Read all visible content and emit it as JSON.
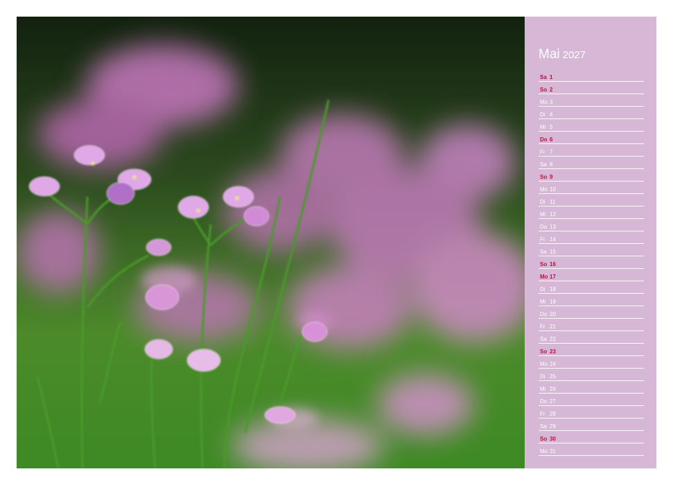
{
  "calendar": {
    "month": "Mai",
    "year": "2027",
    "days": [
      {
        "weekday": "Sa",
        "day": "1",
        "color": "#b0103a"
      },
      {
        "weekday": "So",
        "day": "2",
        "color": "#c0103a"
      },
      {
        "weekday": "Mo",
        "day": "3",
        "color": "#ffffff"
      },
      {
        "weekday": "Di",
        "day": "4",
        "color": "#ffffff"
      },
      {
        "weekday": "Mi",
        "day": "5",
        "color": "#ffffff"
      },
      {
        "weekday": "Do",
        "day": "6",
        "color": "#c0103a"
      },
      {
        "weekday": "Fr",
        "day": "7",
        "color": "#ffffff"
      },
      {
        "weekday": "Sa",
        "day": "8",
        "color": "#ffffff"
      },
      {
        "weekday": "So",
        "day": "9",
        "color": "#c0103a"
      },
      {
        "weekday": "Mo",
        "day": "10",
        "color": "#ffffff"
      },
      {
        "weekday": "Di",
        "day": "11",
        "color": "#ffffff"
      },
      {
        "weekday": "Mi",
        "day": "12",
        "color": "#ffffff"
      },
      {
        "weekday": "Do",
        "day": "13",
        "color": "#ffffff"
      },
      {
        "weekday": "Fr",
        "day": "14",
        "color": "#ffffff"
      },
      {
        "weekday": "Sa",
        "day": "15",
        "color": "#ffffff"
      },
      {
        "weekday": "So",
        "day": "16",
        "color": "#c0103a"
      },
      {
        "weekday": "Mo",
        "day": "17",
        "color": "#c0103a"
      },
      {
        "weekday": "Di",
        "day": "18",
        "color": "#ffffff"
      },
      {
        "weekday": "Mi",
        "day": "19",
        "color": "#ffffff"
      },
      {
        "weekday": "Do",
        "day": "20",
        "color": "#ffffff"
      },
      {
        "weekday": "Fr",
        "day": "21",
        "color": "#ffffff"
      },
      {
        "weekday": "Sa",
        "day": "22",
        "color": "#ffffff"
      },
      {
        "weekday": "So",
        "day": "23",
        "color": "#c0103a"
      },
      {
        "weekday": "Mo",
        "day": "24",
        "color": "#ffffff"
      },
      {
        "weekday": "Di",
        "day": "25",
        "color": "#ffffff"
      },
      {
        "weekday": "Mi",
        "day": "26",
        "color": "#ffffff"
      },
      {
        "weekday": "Do",
        "day": "27",
        "color": "#ffffff"
      },
      {
        "weekday": "Fr",
        "day": "28",
        "color": "#ffffff"
      },
      {
        "weekday": "Sa",
        "day": "29",
        "color": "#ffffff"
      },
      {
        "weekday": "So",
        "day": "30",
        "color": "#c0103a"
      },
      {
        "weekday": "Mo",
        "day": "31",
        "color": "#ffffff"
      }
    ]
  },
  "colors": {
    "sidebar": "#d6b8d6",
    "holiday_red": "#c0103a"
  },
  "photo": {
    "subject": "meadow-flowers-photo"
  }
}
